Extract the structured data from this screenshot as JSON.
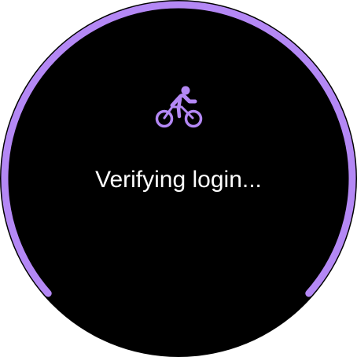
{
  "status": {
    "message": "Verifying login..."
  },
  "progress": {
    "indeterminate": true,
    "fraction_shown": 0.73
  },
  "icon": {
    "name": "bicycle-icon"
  },
  "colors": {
    "accent": "#b488f5",
    "background": "#000000",
    "text": "#ffffff"
  }
}
